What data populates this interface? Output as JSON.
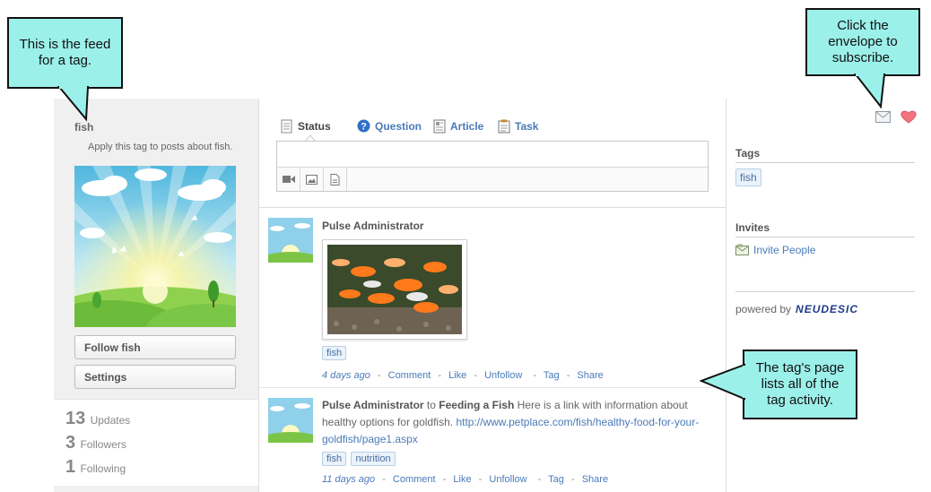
{
  "sidebar": {
    "tag_name": "fish",
    "description": "Apply this tag to posts about fish.",
    "follow_button": "Follow fish",
    "settings_button": "Settings",
    "stats": [
      {
        "num": "13",
        "label": "Updates"
      },
      {
        "num": "3",
        "label": "Followers"
      },
      {
        "num": "1",
        "label": "Following"
      }
    ]
  },
  "composer": {
    "tabs": [
      {
        "label": "Status",
        "icon": "status-icon"
      },
      {
        "label": "Question",
        "icon": "question-icon"
      },
      {
        "label": "Article",
        "icon": "article-icon"
      },
      {
        "label": "Task",
        "icon": "task-icon"
      }
    ],
    "tools": [
      "video-icon",
      "image-icon",
      "file-icon"
    ]
  },
  "posts": [
    {
      "author": "Pulse Administrator",
      "tags": [
        "fish"
      ],
      "time": "4 days ago",
      "actions": [
        "Comment",
        "Like",
        "Unfollow",
        "Tag",
        "Share"
      ]
    },
    {
      "author": "Pulse Administrator",
      "connector": " to ",
      "target": "Feeding a Fish",
      "text": " Here is a link with information about healthy options for goldfish. ",
      "link": "http://www.petplace.com/fish/healthy-food-for-your-goldfish/page1.aspx",
      "tags": [
        "fish",
        "nutrition"
      ],
      "time": "11 days ago",
      "actions": [
        "Comment",
        "Like",
        "Unfollow",
        "Tag",
        "Share"
      ]
    }
  ],
  "right": {
    "tags_heading": "Tags",
    "tags": [
      "fish"
    ],
    "invites_heading": "Invites",
    "invite_link": "Invite People",
    "powered_by": "powered by",
    "brand": "NEUDESIC"
  },
  "callouts": {
    "feed": "This is the feed for a tag.",
    "subscribe": "Click the envelope to subscribe.",
    "activity": "The tag's page lists all of the tag activity."
  },
  "colors": {
    "accent": "#4a7ab8",
    "callout_bg": "#9cf0ea",
    "brand": "#1f3c8a"
  }
}
